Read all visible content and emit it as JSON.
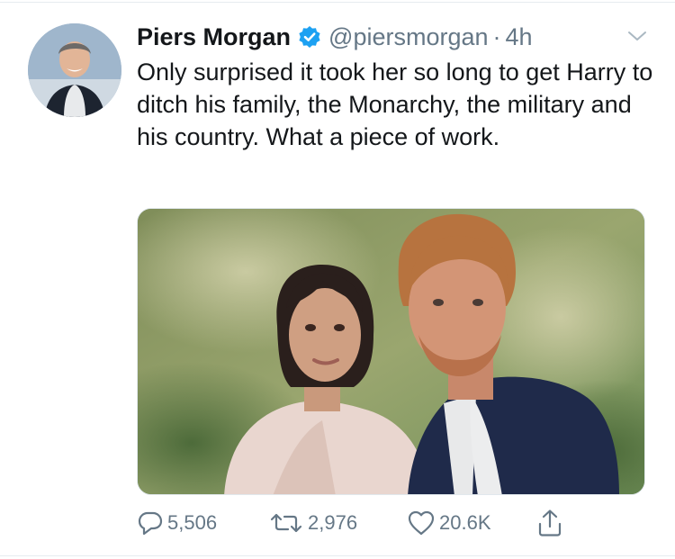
{
  "tweet": {
    "author_name": "Piers Morgan",
    "handle": "@piersmorgan",
    "separator": "·",
    "time": "4h",
    "text": "Only surprised it took her so long to get Harry to ditch his family, the Monarchy, the military and his country. What a piece of work.",
    "verified_icon": "verified-badge-icon",
    "menu_icon": "chevron-down-icon"
  },
  "actions": {
    "replies": "5,506",
    "retweets": "2,976",
    "likes": "20.6K"
  },
  "colors": {
    "text_primary": "#14171a",
    "text_secondary": "#657786",
    "verified_blue": "#1da1f2",
    "divider": "#e6ecf0"
  }
}
